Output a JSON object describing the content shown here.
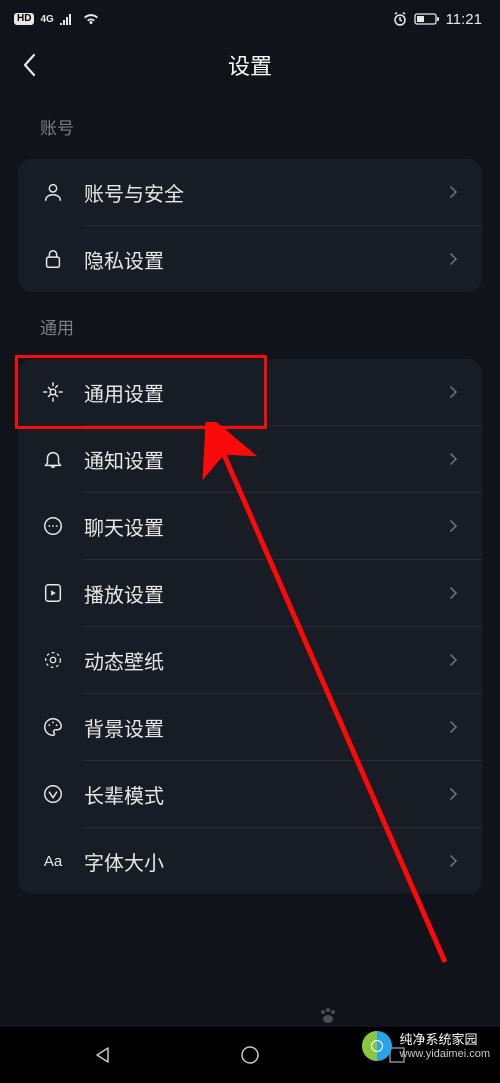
{
  "status_bar": {
    "hd": "HD",
    "signal_label": "4G",
    "time": "11:21"
  },
  "header": {
    "title": "设置"
  },
  "sections": [
    {
      "title": "账号",
      "items": [
        {
          "icon": "user-icon",
          "label": "账号与安全",
          "highlighted": false
        },
        {
          "icon": "lock-icon",
          "label": "隐私设置",
          "highlighted": false
        }
      ]
    },
    {
      "title": "通用",
      "items": [
        {
          "icon": "gear-icon",
          "label": "通用设置",
          "highlighted": true
        },
        {
          "icon": "bell-icon",
          "label": "通知设置",
          "highlighted": false
        },
        {
          "icon": "chat-icon",
          "label": "聊天设置",
          "highlighted": false
        },
        {
          "icon": "play-icon",
          "label": "播放设置",
          "highlighted": false
        },
        {
          "icon": "wallpaper-icon",
          "label": "动态壁纸",
          "highlighted": false
        },
        {
          "icon": "palette-icon",
          "label": "背景设置",
          "highlighted": false
        },
        {
          "icon": "elder-icon",
          "label": "长辈模式",
          "highlighted": false
        },
        {
          "icon": "font-icon",
          "label": "字体大小",
          "highlighted": false
        }
      ]
    }
  ],
  "watermark": {
    "brand": "纯净系统家园",
    "url": "www.yidaimei.com"
  },
  "colors": {
    "highlight": "#fc0a0a",
    "bg": "#10131a",
    "card": "#181c25"
  }
}
